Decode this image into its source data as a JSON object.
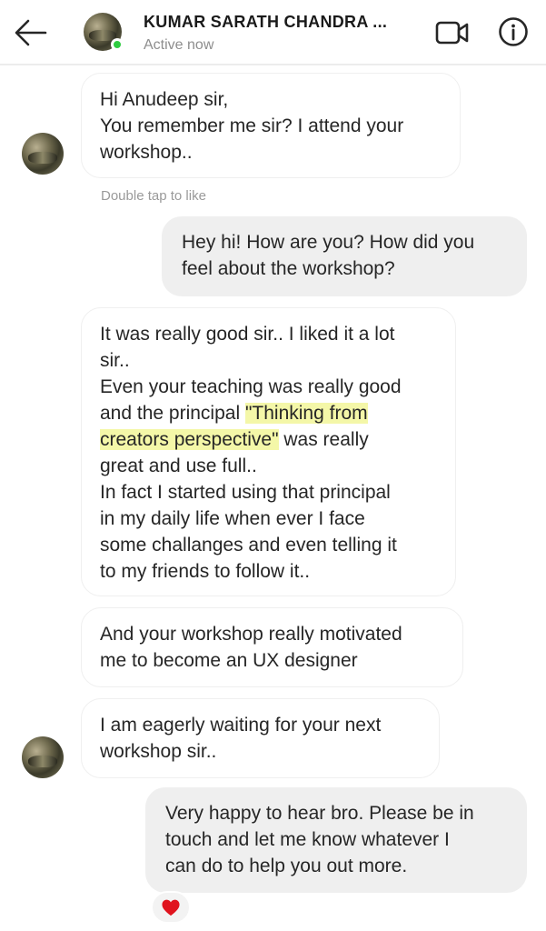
{
  "header": {
    "contact_name": "KUMAR SARATH CHANDRA ...",
    "status": "Active now",
    "icons": [
      "back-arrow-icon",
      "video-call-icon",
      "info-icon"
    ]
  },
  "colors": {
    "online_dot": "#2ecc40",
    "outgoing_bubble": "#efefef",
    "incoming_border": "#efefef",
    "highlight": "#f4f7a8",
    "heart": "#e0141e"
  },
  "messages": [
    {
      "from": "them",
      "text": "Hi Anudeep sir,\nYou remember me sir? I attend your\nworkshop.."
    },
    {
      "from": "me",
      "text": "Hey hi! How are you? How did you\nfeel about the workshop?"
    },
    {
      "from": "them",
      "text_before": "It was really good sir.. I liked it a lot\nsir..\nEven your teaching was really good\nand the principal ",
      "highlight_1": "\"Thinking from",
      "highlight_2": "creators perspective\"",
      "text_after": " was really\ngreat and use full..\nIn fact I started using that principal\nin my daily life when ever I face\nsome challanges and even telling it\nto my friends to follow it.."
    },
    {
      "from": "them",
      "text": "And your workshop really motivated\nme to become an UX designer"
    },
    {
      "from": "them",
      "text": "I am eagerly waiting for your next\nworkshop sir.."
    },
    {
      "from": "me",
      "text": "Very happy to hear bro. Please be in\ntouch and let me know whatever I\ncan do to help you out more."
    }
  ],
  "hint_text": "Double tap to like",
  "reaction": "heart-icon"
}
